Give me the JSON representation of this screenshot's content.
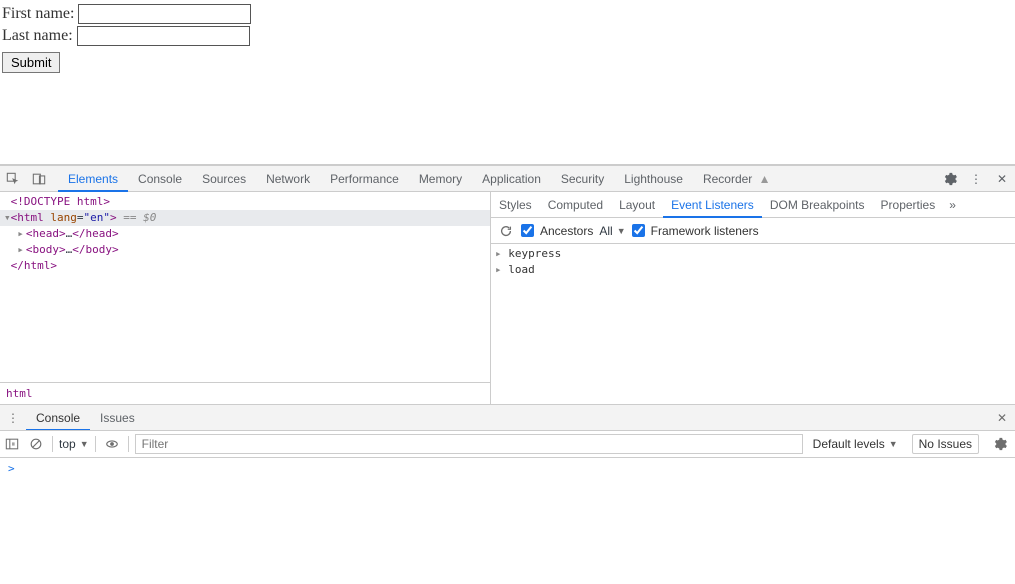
{
  "page": {
    "first_label": "First name:",
    "last_label": "Last name:",
    "first_value": "",
    "last_value": "",
    "submit": "Submit"
  },
  "devtools": {
    "main_tabs": [
      "Elements",
      "Console",
      "Sources",
      "Network",
      "Performance",
      "Memory",
      "Application",
      "Security",
      "Lighthouse",
      "Recorder"
    ],
    "main_active": "Elements",
    "dom": {
      "doctype": "<!DOCTYPE html>",
      "html_open_prefix": "<html ",
      "html_attr_name": "lang",
      "html_attr_val": "\"en\"",
      "html_open_suffix": ">",
      "s0": " == $0",
      "head_open": "<head>",
      "head_ell": "…",
      "head_close": "</head>",
      "body_open": "<body>",
      "body_ell": "…",
      "body_close": "</body>",
      "html_close": "</html>"
    },
    "breadcrumb": "html",
    "side_tabs": [
      "Styles",
      "Computed",
      "Layout",
      "Event Listeners",
      "DOM Breakpoints",
      "Properties"
    ],
    "side_active": "Event Listeners",
    "listeners": {
      "ancestors_label": "Ancestors",
      "ancestors_checked": true,
      "filter_value": "All",
      "framework_label": "Framework listeners",
      "framework_checked": true,
      "events": [
        "keypress",
        "load"
      ]
    },
    "lower_tabs": [
      "Console",
      "Issues"
    ],
    "lower_active": "Console",
    "console": {
      "context": "top",
      "filter_placeholder": "Filter",
      "levels": "Default levels",
      "no_issues": "No Issues",
      "prompt": ">"
    }
  }
}
